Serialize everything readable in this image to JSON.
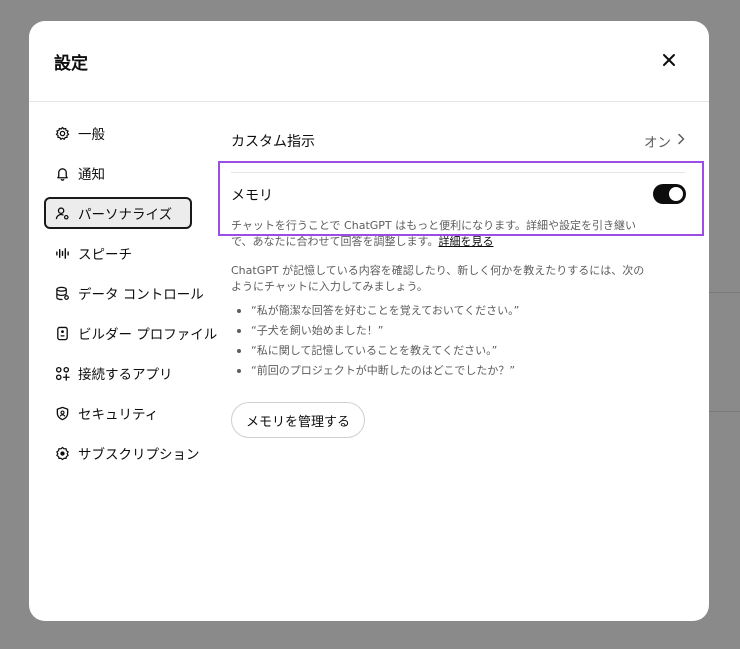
{
  "dialog": {
    "title": "設定",
    "close_icon": "close-icon"
  },
  "sidebar": {
    "items": [
      {
        "label": "一般",
        "icon": "gear-icon",
        "active": false
      },
      {
        "label": "通知",
        "icon": "bell-icon",
        "active": false
      },
      {
        "label": "パーソナライズ",
        "icon": "user-personalize-icon",
        "active": true
      },
      {
        "label": "スピーチ",
        "icon": "waveform-icon",
        "active": false
      },
      {
        "label": "データ コントロール",
        "icon": "database-icon",
        "active": false
      },
      {
        "label": "ビルダー プロファイル",
        "icon": "id-card-icon",
        "active": false
      },
      {
        "label": "接続するアプリ",
        "icon": "apps-grid-icon",
        "active": false
      },
      {
        "label": "セキュリティ",
        "icon": "shield-icon",
        "active": false
      },
      {
        "label": "サブスクリプション",
        "icon": "subscription-icon",
        "active": false
      }
    ]
  },
  "personalize": {
    "custom_instructions_label": "カスタム指示",
    "custom_instructions_value": "オン",
    "memory": {
      "title": "メモリ",
      "enabled": true,
      "description": "チャットを行うことで ChatGPT はもっと便利になります。詳細や設定を引き継いで、あなたに合わせて回答を調整します。",
      "learn_more_link": "詳細を見る",
      "explanation": "ChatGPT が記憶している内容を確認したり、新しく何かを教えたりするには、次のようにチャットに入力してみましょう。",
      "examples": [
        "“私が簡潔な回答を好むことを覚えておいてください。”",
        "“子犬を飼い始めました！”",
        "“私に関して記憶していることを教えてください。”",
        "“前回のプロジェクトが中断したのはどこでしたか？”"
      ],
      "manage_button": "メモリを管理する"
    }
  },
  "colors": {
    "highlight_border": "#9b4de6",
    "toggle_on": "#0d0d0d",
    "backdrop": "#8a8a8a"
  }
}
